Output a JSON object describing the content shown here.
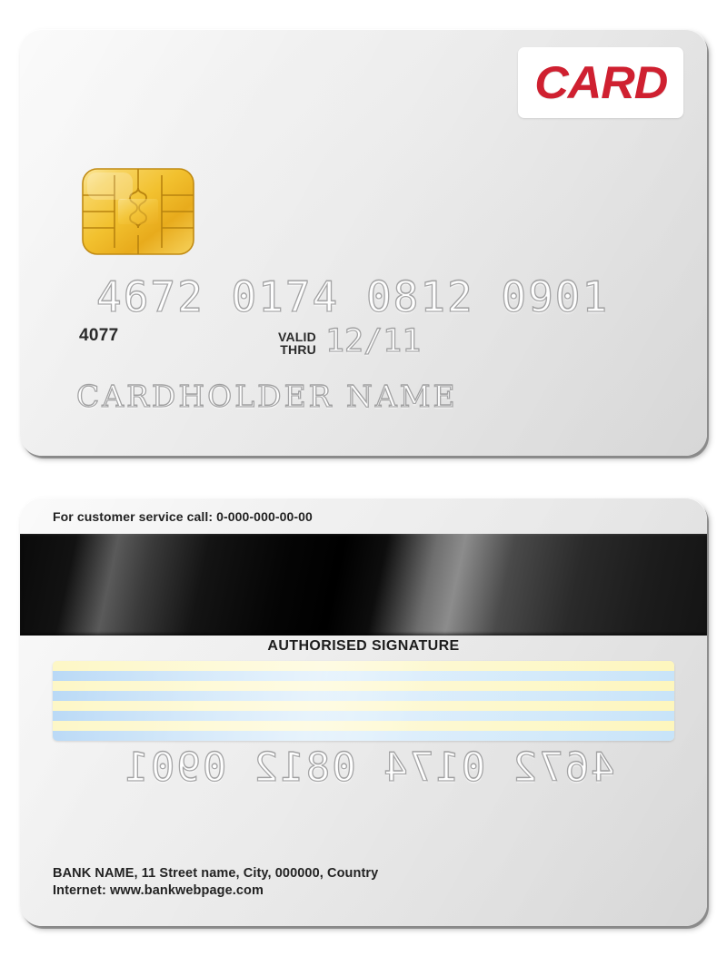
{
  "colors": {
    "brand_red": "#cf2030",
    "card_light": "#f2f2f2",
    "card_dark": "#e2e2e2",
    "magstripe_black": "#0a0a0a",
    "signature_yellow": "#fdf7c6",
    "signature_blue": "#b9d9f6",
    "text_dark": "#222222",
    "chip_gold": "#f5c330"
  },
  "front": {
    "brand_logo": "CARD",
    "chip_icon_name": "emv-chip-icon",
    "card_number": "4672 0174 0812 0901",
    "bin_digits": "4077",
    "valid_label_line1": "VALID",
    "valid_label_line2": "THRU",
    "expiry": "12/11",
    "cardholder_name": "CARDHOLDER NAME"
  },
  "back": {
    "service_line": "For customer service call: 0-000-000-00-00",
    "magstripe_name": "magnetic-stripe",
    "authorised_signature_label": "AUTHORISED SIGNATURE",
    "signature_strip_name": "signature-strip",
    "mirrored_card_number": "4672 0174 0812 0901",
    "bank_address": "BANK NAME, 11 Street name, City, 000000, Country",
    "bank_internet": "Internet: www.bankwebpage.com"
  }
}
